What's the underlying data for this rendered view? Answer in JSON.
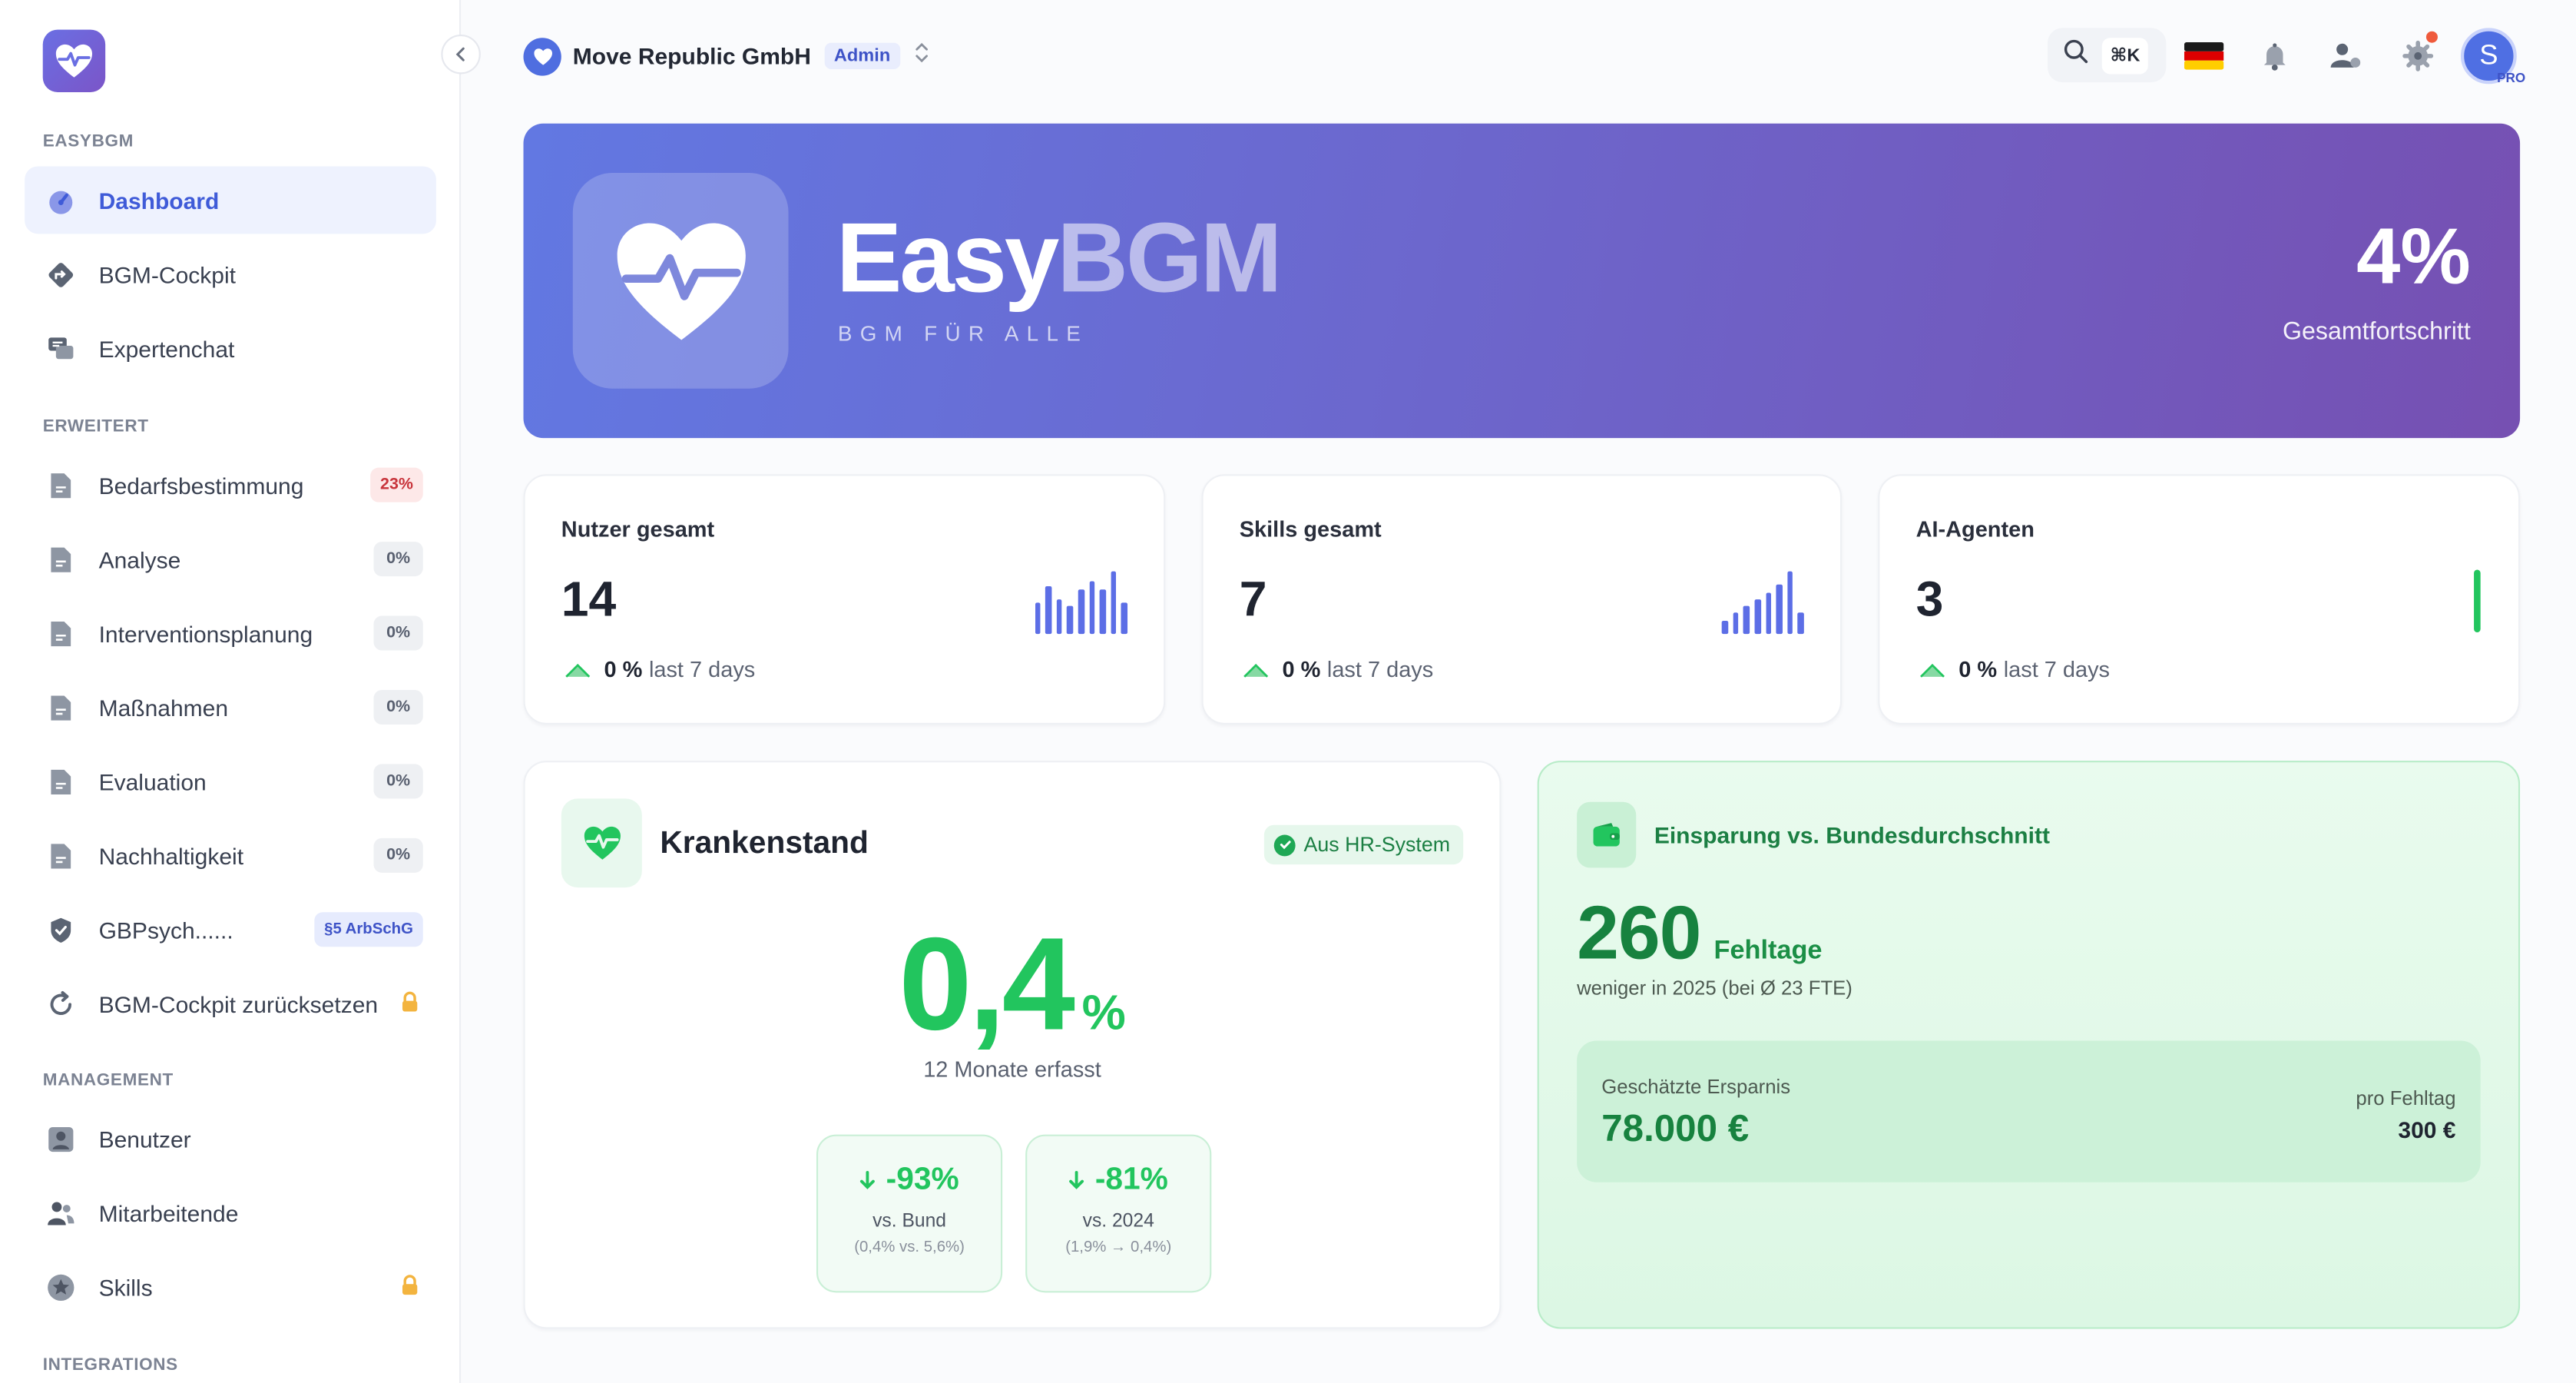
{
  "sidebar": {
    "sections": {
      "easybgm": "EASYBGM",
      "erweitert": "ERWEITERT",
      "management": "MANAGEMENT",
      "integrations": "INTEGRATIONS"
    },
    "items": [
      {
        "label": "Dashboard",
        "icon": "gauge-icon",
        "active": true
      },
      {
        "label": "BGM-Cockpit",
        "icon": "route-icon"
      },
      {
        "label": "Expertenchat",
        "icon": "chat-icon"
      },
      {
        "label": "Bedarfsbestimmung",
        "icon": "document-icon",
        "badge": "23%"
      },
      {
        "label": "Analyse",
        "icon": "document-icon",
        "badge": "0%"
      },
      {
        "label": "Interventionsplanung",
        "icon": "document-icon",
        "badge": "0%"
      },
      {
        "label": "Maßnahmen",
        "icon": "document-icon",
        "badge": "0%"
      },
      {
        "label": "Evaluation",
        "icon": "document-icon",
        "badge": "0%"
      },
      {
        "label": "Nachhaltigkeit",
        "icon": "document-icon",
        "badge": "0%"
      },
      {
        "label": "GBPsych......",
        "icon": "shield-check-icon",
        "badge": "§5 ArbSchG"
      },
      {
        "label": "BGM-Cockpit zurücksetzen",
        "icon": "reset-icon",
        "locked": true
      },
      {
        "label": "Benutzer",
        "icon": "user-icon"
      },
      {
        "label": "Mitarbeitende",
        "icon": "users-icon"
      },
      {
        "label": "Skills",
        "icon": "star-icon",
        "locked": true
      }
    ]
  },
  "header": {
    "org_name": "Move Republic GmbH",
    "role": "Admin",
    "shortcut": "⌘K",
    "avatar_initial": "S",
    "plan": "PRO"
  },
  "hero": {
    "title_part1": "Easy",
    "title_part2": "BGM",
    "subtitle": "BGM FÜR ALLE",
    "progress_value": "4%",
    "progress_label": "Gesamtfortschritt"
  },
  "stats": [
    {
      "title": "Nutzer gesamt",
      "value": "14",
      "trend_value": "0 %",
      "trend_label": "last 7 days",
      "spark": [
        0.5,
        0.75,
        0.55,
        0.45,
        0.7,
        0.85,
        0.7,
        1.0,
        0.5
      ]
    },
    {
      "title": "Skills gesamt",
      "value": "7",
      "trend_value": "0 %",
      "trend_label": "last 7 days",
      "spark": [
        0.2,
        0.35,
        0.45,
        0.55,
        0.65,
        0.8,
        1.0,
        0.35
      ]
    },
    {
      "title": "AI-Agenten",
      "value": "3",
      "trend_value": "0 %",
      "trend_label": "last 7 days"
    }
  ],
  "krankenstand": {
    "title": "Krankenstand",
    "source_badge": "Aus HR-System",
    "value": "0,4",
    "unit": "%",
    "subtitle": "12 Monate erfasst",
    "comparisons": [
      {
        "value": "-93%",
        "label": "vs. Bund",
        "detail": "(0,4% vs. 5,6%)"
      },
      {
        "value": "-81%",
        "label": "vs. 2024",
        "detail": "(1,9% → 0,4%)"
      }
    ]
  },
  "einsparung": {
    "title": "Einsparung vs. Bundesdurchschnitt",
    "value": "260",
    "unit": "Fehltage",
    "subtitle": "weniger in 2025 (bei Ø 23 FTE)",
    "savings_label": "Geschätzte Ersparnis",
    "savings_value": "78.000 €",
    "per_day_label": "pro Fehltag",
    "per_day_value": "300 €"
  },
  "colors": {
    "accent": "#4f6ee0",
    "success": "#22c55e",
    "hero_start": "#6278e2",
    "hero_end": "#7650b2"
  }
}
